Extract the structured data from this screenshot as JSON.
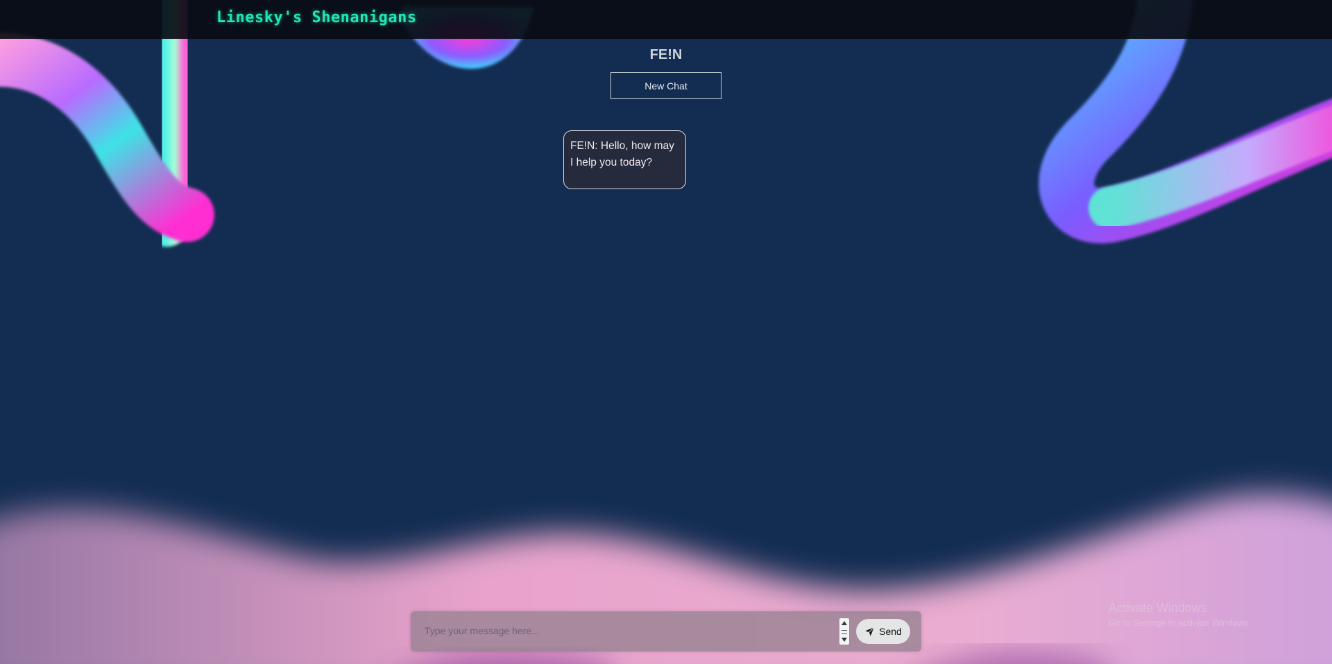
{
  "header": {
    "brand": "Linesky's Shenanigans"
  },
  "chat": {
    "title": "FE!N",
    "new_chat_label": "New Chat",
    "messages": [
      {
        "text": "FE!N: Hello, how may I help you today?"
      }
    ]
  },
  "composer": {
    "placeholder": "Type your message here...",
    "send_label": "Send"
  },
  "watermark": {
    "title": "Activate Windows",
    "subtitle": "Go to Settings to activate Windows."
  },
  "colors": {
    "background": "#132d52",
    "brand_accent": "#1ee8b5",
    "bubble_bg": "#252b3c",
    "wave_pink": "#f0a8d0"
  },
  "icons": {
    "send": "paper-plane-icon"
  }
}
